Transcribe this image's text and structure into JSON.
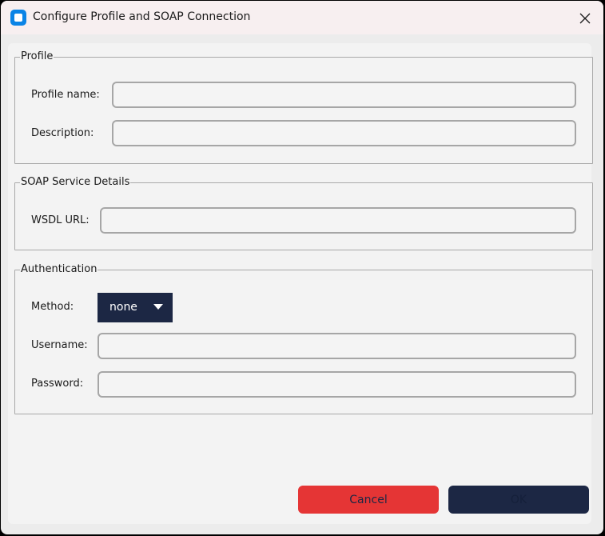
{
  "window": {
    "title": "Configure Profile and SOAP Connection"
  },
  "profile": {
    "legend": "Profile",
    "name_label": "Profile name:",
    "name_value": "",
    "description_label": "Description:",
    "description_value": ""
  },
  "soap": {
    "legend": "SOAP Service Details",
    "wsdl_label": "WSDL URL:",
    "wsdl_value": ""
  },
  "auth": {
    "legend": "Authentication",
    "method_label": "Method:",
    "method_value": "none",
    "username_label": "Username:",
    "username_value": "",
    "password_label": "Password:",
    "password_value": ""
  },
  "buttons": {
    "cancel": "Cancel",
    "ok": "OK"
  },
  "colors": {
    "cancel_bg": "#e53535",
    "ok_bg": "#1c2744",
    "dropdown_bg": "#1c2744",
    "app_icon": "#0a84e6"
  },
  "icons": {
    "app": "app-window-icon",
    "close": "close-icon",
    "dropdown": "caret-down-icon"
  }
}
